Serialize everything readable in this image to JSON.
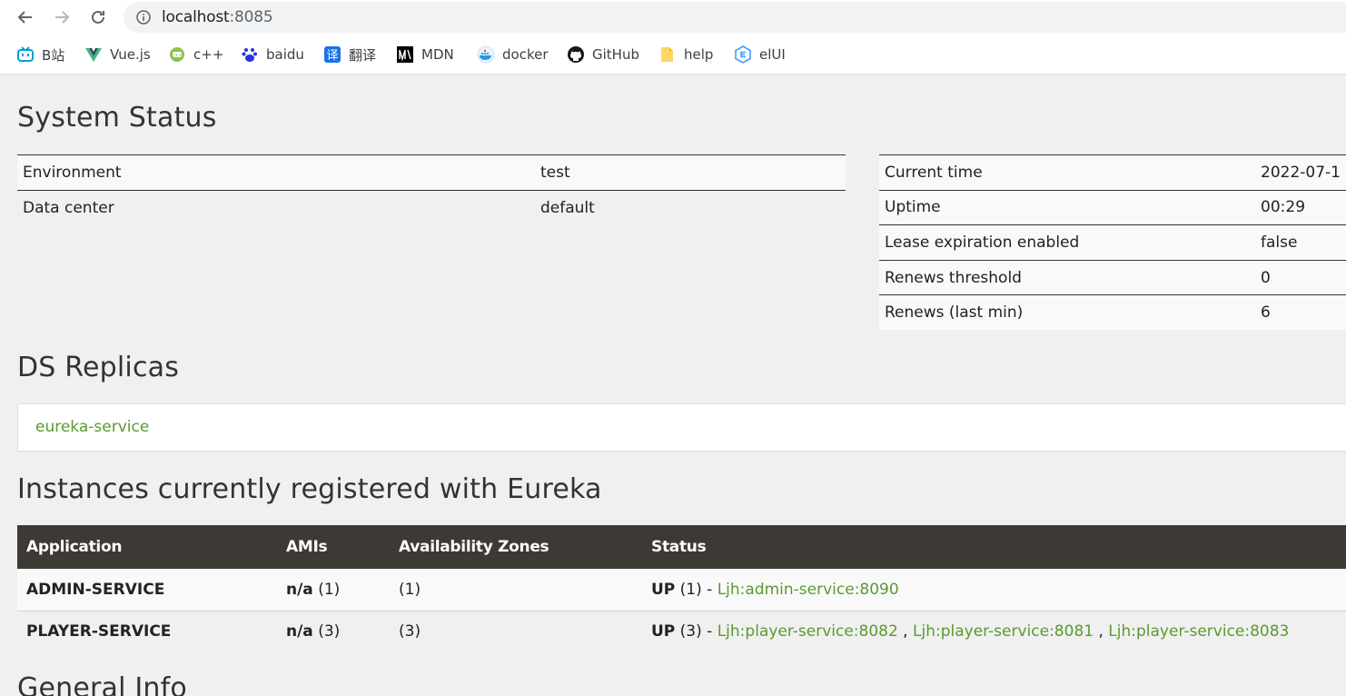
{
  "browser": {
    "url_host": "localhost",
    "url_port": ":8085",
    "bookmarks": [
      {
        "label": "B站",
        "icon": "bilibili-icon"
      },
      {
        "label": "Vue.js",
        "icon": "vue-icon"
      },
      {
        "label": "c++",
        "icon": "cpp-icon"
      },
      {
        "label": "baidu",
        "icon": "baidu-icon"
      },
      {
        "label": "翻译",
        "icon": "translate-icon"
      },
      {
        "label": "MDN",
        "icon": "mdn-icon"
      },
      {
        "label": "docker",
        "icon": "docker-icon"
      },
      {
        "label": "GitHub",
        "icon": "github-icon"
      },
      {
        "label": "help",
        "icon": "folder-icon"
      },
      {
        "label": "elUI",
        "icon": "element-ui-icon"
      }
    ]
  },
  "system_status": {
    "title": "System Status",
    "left": [
      {
        "key": "Environment",
        "value": "test"
      },
      {
        "key": "Data center",
        "value": "default"
      }
    ],
    "right": [
      {
        "key": "Current time",
        "value": "2022-07-1"
      },
      {
        "key": "Uptime",
        "value": "00:29"
      },
      {
        "key": "Lease expiration enabled",
        "value": "false"
      },
      {
        "key": "Renews threshold",
        "value": "0"
      },
      {
        "key": "Renews (last min)",
        "value": "6"
      }
    ]
  },
  "replicas": {
    "title": "DS Replicas",
    "link": "eureka-service"
  },
  "instances": {
    "title": "Instances currently registered with Eureka",
    "headers": [
      "Application",
      "AMIs",
      "Availability Zones",
      "Status"
    ],
    "rows": [
      {
        "app": "ADMIN-SERVICE",
        "amis_bold": "n/a",
        "amis_count": " (1)",
        "zones": "(1)",
        "status_bold": "UP",
        "status_count": " (1) - ",
        "links": [
          "Ljh:admin-service:8090"
        ]
      },
      {
        "app": "PLAYER-SERVICE",
        "amis_bold": "n/a",
        "amis_count": " (3)",
        "zones": "(3)",
        "status_bold": "UP",
        "status_count": " (3) - ",
        "links": [
          "Ljh:player-service:8082",
          "Ljh:player-service:8081",
          "Ljh:player-service:8083"
        ]
      }
    ]
  },
  "general_info": {
    "title": "General Info"
  },
  "colors": {
    "link_green": "#5a9a2f",
    "table_header": "#3d3a35",
    "page_bg": "#f0f0f0"
  }
}
